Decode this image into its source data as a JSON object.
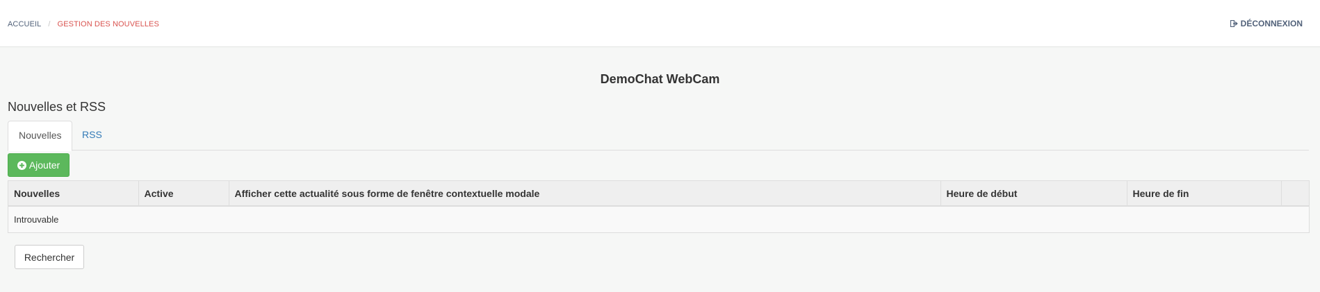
{
  "breadcrumb": {
    "home": "ACCUEIL",
    "separator": "/",
    "current": "GESTION DES NOUVELLES"
  },
  "logout": {
    "label": "DÉCONNEXION",
    "icon": "sign-out-icon"
  },
  "app_title": "DemoChat WebCam",
  "section_title": "Nouvelles et RSS",
  "tabs": [
    {
      "label": "Nouvelles",
      "active": true
    },
    {
      "label": "RSS",
      "active": false
    }
  ],
  "add_button": {
    "label": "Ajouter",
    "icon": "plus-circle-icon"
  },
  "table": {
    "columns": [
      "Nouvelles",
      "Active",
      "Afficher cette actualité sous forme de fenêtre contextuelle modale",
      "Heure de début",
      "Heure de fin",
      ""
    ],
    "empty_message": "Introuvable"
  },
  "search_button": {
    "label": "Rechercher"
  },
  "colors": {
    "accent_blue": "#337ab7",
    "breadcrumb_active": "#d9534f",
    "success_green": "#5cb85c",
    "nav_text": "#52627a"
  }
}
